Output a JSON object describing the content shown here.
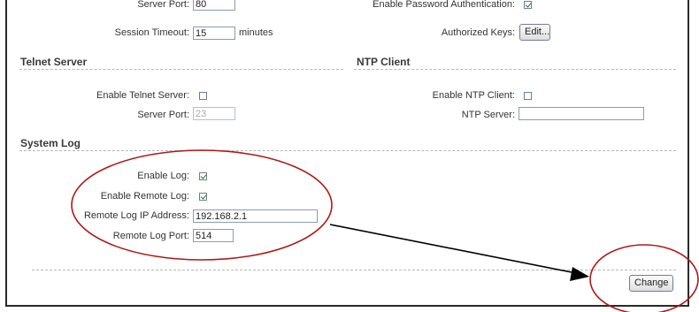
{
  "ssh": {
    "server_port_label": "Server Port:",
    "server_port_value": "80",
    "session_timeout_label": "Session Timeout:",
    "session_timeout_value": "15",
    "session_timeout_unit": "minutes",
    "enable_password_auth_label": "Enable Password Authentication:",
    "enable_password_auth_checked": true,
    "authorized_keys_label": "Authorized Keys:",
    "edit_button": "Edit..."
  },
  "telnet": {
    "title": "Telnet Server",
    "enable_label": "Enable Telnet Server:",
    "enable_checked": false,
    "port_label": "Server Port:",
    "port_value": "23"
  },
  "ntp": {
    "title": "NTP Client",
    "enable_label": "Enable NTP Client:",
    "enable_checked": false,
    "server_label": "NTP Server:",
    "server_value": ""
  },
  "syslog": {
    "title": "System Log",
    "enable_label": "Enable Log:",
    "enable_checked": true,
    "remote_label": "Enable Remote Log:",
    "remote_checked": true,
    "ip_label": "Remote Log IP Address:",
    "ip_value": "192.168.2.1",
    "port_label": "Remote Log Port:",
    "port_value": "514"
  },
  "footer": {
    "change_button": "Change"
  },
  "annotation_colors": {
    "ellipse": "#b01818",
    "arrow": "#000000"
  }
}
